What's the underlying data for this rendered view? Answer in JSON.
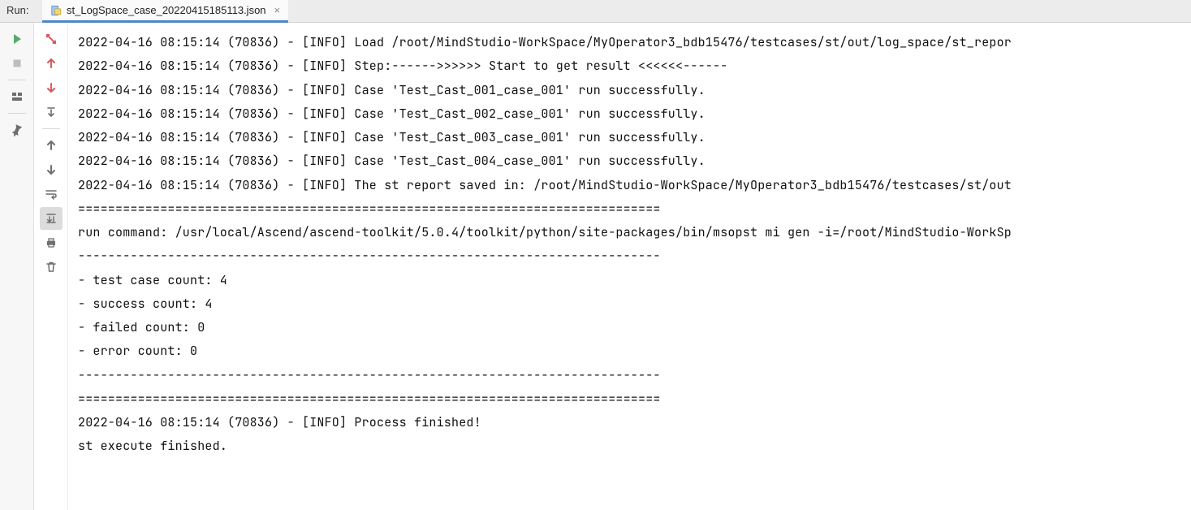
{
  "header": {
    "run_label": "Run:",
    "tab_title": "st_LogSpace_case_20220415185113.json"
  },
  "console_lines": [
    "2022-04-16 08:15:14 (70836) - [INFO] Load /root/MindStudio-WorkSpace/MyOperator3_bdb15476/testcases/st/out/log_space/st_repor",
    "2022-04-16 08:15:14 (70836) - [INFO] Step:------>>>>>> Start to get result <<<<<<------",
    "2022-04-16 08:15:14 (70836) - [INFO] Case 'Test_Cast_001_case_001' run successfully.",
    "2022-04-16 08:15:14 (70836) - [INFO] Case 'Test_Cast_002_case_001' run successfully.",
    "2022-04-16 08:15:14 (70836) - [INFO] Case 'Test_Cast_003_case_001' run successfully.",
    "2022-04-16 08:15:14 (70836) - [INFO] Case 'Test_Cast_004_case_001' run successfully.",
    "2022-04-16 08:15:14 (70836) - [INFO] The st report saved in: /root/MindStudio-WorkSpace/MyOperator3_bdb15476/testcases/st/out",
    "==============================================================================",
    "run command: /usr/local/Ascend/ascend-toolkit/5.0.4/toolkit/python/site-packages/bin/msopst mi gen -i=/root/MindStudio-WorkSp",
    "------------------------------------------------------------------------------",
    "- test case count: 4",
    "- success count: 4",
    "- failed count: 0",
    "- error count: 0",
    "------------------------------------------------------------------------------",
    "==============================================================================",
    "2022-04-16 08:15:14 (70836) - [INFO] Process finished!",
    "st execute finished."
  ]
}
